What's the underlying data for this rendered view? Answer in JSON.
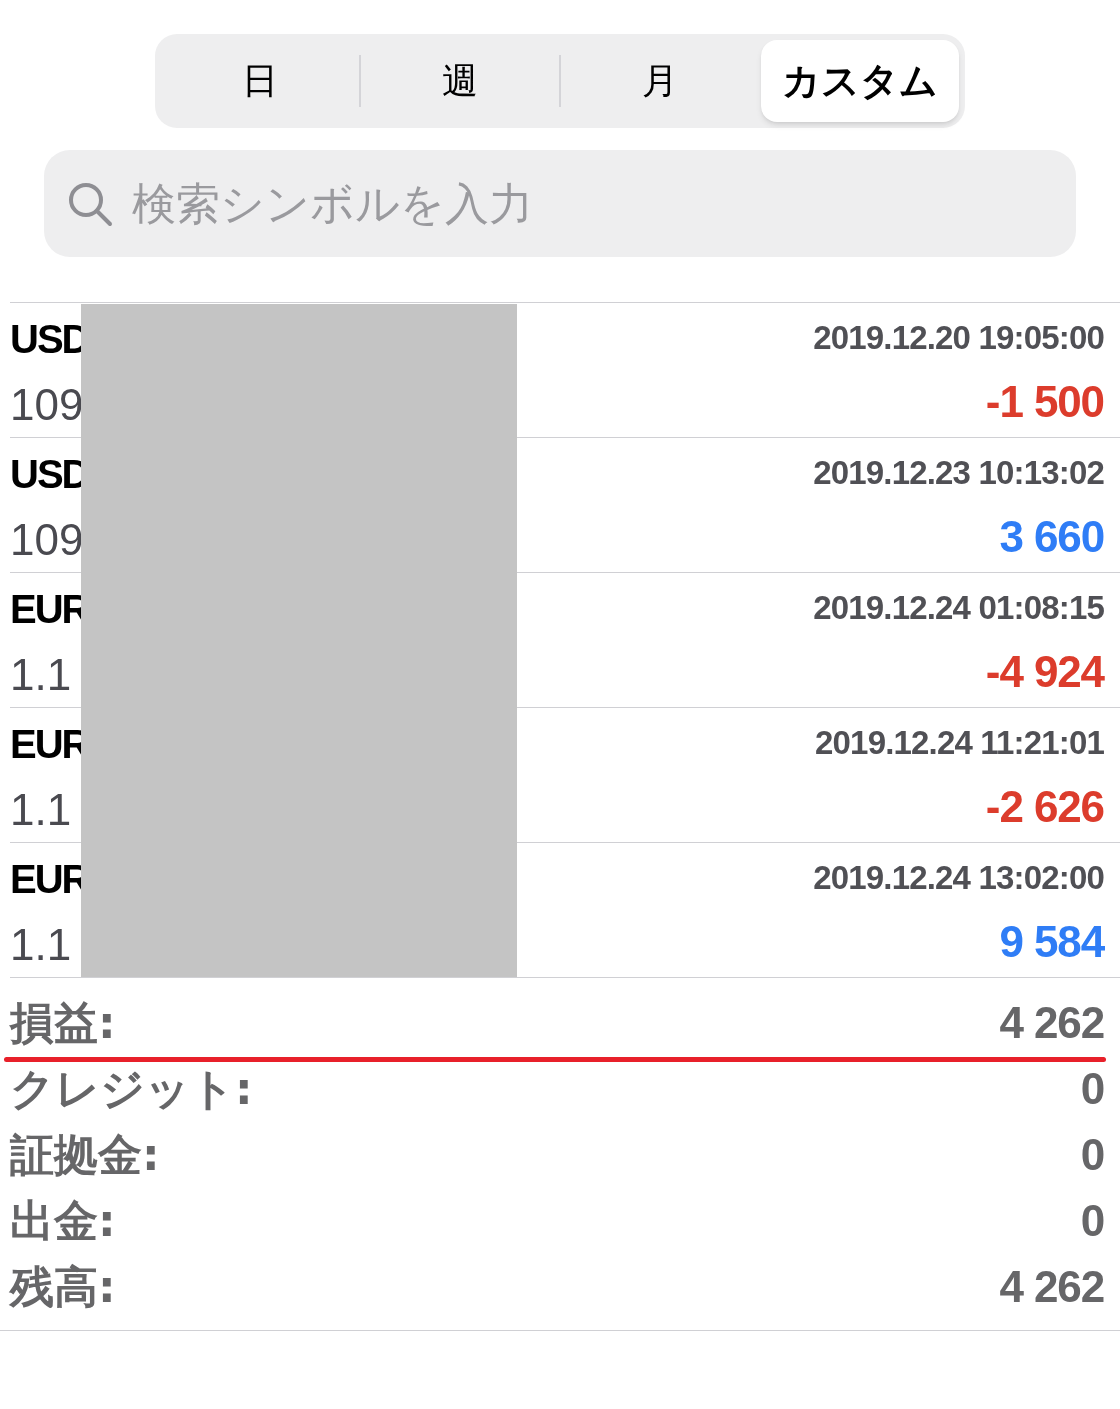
{
  "period_tabs": [
    {
      "label": "日",
      "selected": false
    },
    {
      "label": "週",
      "selected": false
    },
    {
      "label": "月",
      "selected": false
    },
    {
      "label": "カスタム",
      "selected": true
    }
  ],
  "search": {
    "placeholder": "検索シンボルを入力"
  },
  "deals": [
    {
      "symbol": "USD",
      "price": "109",
      "time": "2019.12.20 19:05:00",
      "profit": "-1 500",
      "kind": "loss"
    },
    {
      "symbol": "USD",
      "price": "109",
      "time": "2019.12.23 10:13:02",
      "profit": "3 660",
      "kind": "gain"
    },
    {
      "symbol": "EUR",
      "price": "1.1",
      "time": "2019.12.24 01:08:15",
      "profit": "-4 924",
      "kind": "loss"
    },
    {
      "symbol": "EUR",
      "price": "1.1",
      "time": "2019.12.24 11:21:01",
      "profit": "-2 626",
      "kind": "loss"
    },
    {
      "symbol": "EUR",
      "price": "1.1",
      "time": "2019.12.24 13:02:00",
      "profit": "9 584",
      "kind": "gain"
    }
  ],
  "summary": [
    {
      "label": "損益:",
      "value": "4 262",
      "underlined": true
    },
    {
      "label": "クレジット:",
      "value": "0",
      "underlined": false
    },
    {
      "label": "証拠金:",
      "value": "0",
      "underlined": false
    },
    {
      "label": "出金:",
      "value": "0",
      "underlined": false
    },
    {
      "label": "残高:",
      "value": "4 262",
      "underlined": false
    }
  ]
}
